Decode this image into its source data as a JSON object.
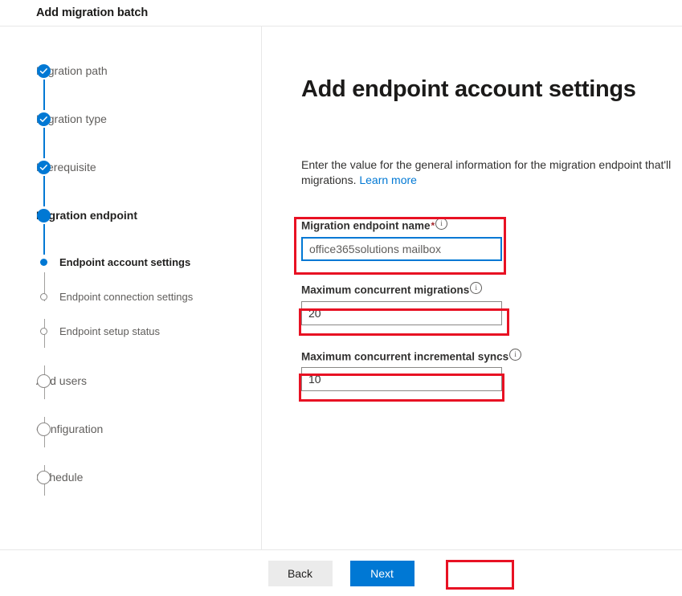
{
  "window": {
    "title": "Add migration batch"
  },
  "wizard": {
    "steps": [
      {
        "label": "Migration path",
        "state": "done",
        "kind": "main"
      },
      {
        "label": "Migration type",
        "state": "done",
        "kind": "main"
      },
      {
        "label": "Prerequisite",
        "state": "done",
        "kind": "main"
      },
      {
        "label": "Migration endpoint",
        "state": "current",
        "kind": "main"
      },
      {
        "label": "Endpoint account settings",
        "state": "sub-current",
        "kind": "sub"
      },
      {
        "label": "Endpoint connection settings",
        "state": "sub-empty",
        "kind": "sub"
      },
      {
        "label": "Endpoint setup status",
        "state": "sub-empty",
        "kind": "sub"
      },
      {
        "label": "Add users",
        "state": "empty",
        "kind": "main"
      },
      {
        "label": "Configuration",
        "state": "empty",
        "kind": "main"
      },
      {
        "label": "Schedule",
        "state": "empty",
        "kind": "main"
      }
    ]
  },
  "main": {
    "title": "Add endpoint account settings",
    "description": "Enter the value for the general information for the migration endpoint that'll migrations.",
    "learn_more": "Learn more",
    "fields": {
      "endpoint_name": {
        "label": "Migration endpoint name",
        "required_marker": "*",
        "info_glyph": "i",
        "value": "office365solutions mailbox",
        "placeholder": "office365solutions mailbox"
      },
      "max_concurrent_migrations": {
        "label": "Maximum concurrent migrations",
        "info_glyph": "i",
        "value": "20",
        "placeholder": "20"
      },
      "max_concurrent_incremental_syncs": {
        "label": "Maximum concurrent incremental syncs",
        "info_glyph": "i",
        "value": "10",
        "placeholder": "10"
      }
    }
  },
  "footer": {
    "back_label": "Back",
    "next_label": "Next"
  },
  "colors": {
    "accent": "#0078d4",
    "annotation": "#e81123",
    "required": "#a4262c",
    "muted_text": "#605e5c",
    "divider": "#e8e8e8"
  }
}
